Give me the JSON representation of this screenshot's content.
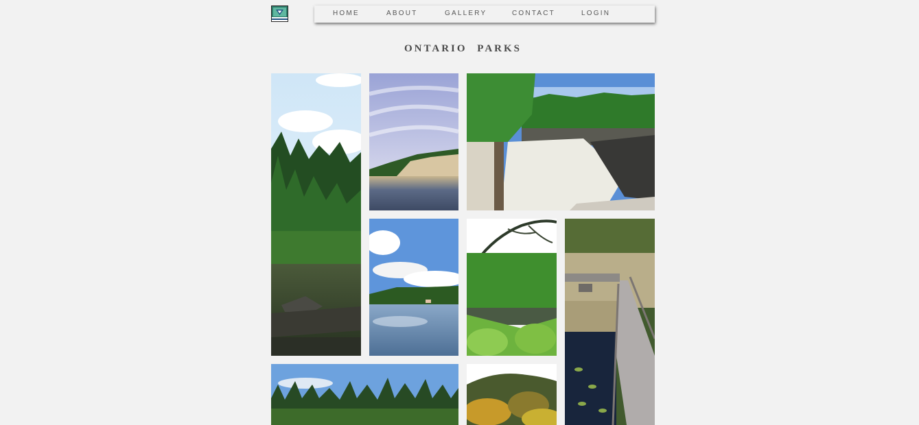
{
  "header": {
    "logo_icon": "ontario-parks-logo-icon",
    "nav": {
      "home": "HOME",
      "about": "ABOUT",
      "gallery": "GALLERY",
      "contact": "CONTACT",
      "login": "LOGIN"
    }
  },
  "page": {
    "title": "ONTARIO  PARKS"
  },
  "gallery": {
    "photos": [
      {
        "id": "forest-river-tall",
        "subject": "forest river"
      },
      {
        "id": "cliff-lake",
        "subject": "cliff over lake"
      },
      {
        "id": "waterfall-rapids",
        "subject": "waterfall rapids"
      },
      {
        "id": "lake-clouds",
        "subject": "lake with clouds"
      },
      {
        "id": "forest-overlook",
        "subject": "forest overlook"
      },
      {
        "id": "boardwalk-marsh",
        "subject": "boardwalk over marsh"
      },
      {
        "id": "pine-forest-lake",
        "subject": "pine forest by lake"
      },
      {
        "id": "autumn-hills",
        "subject": "autumn hills"
      }
    ]
  }
}
